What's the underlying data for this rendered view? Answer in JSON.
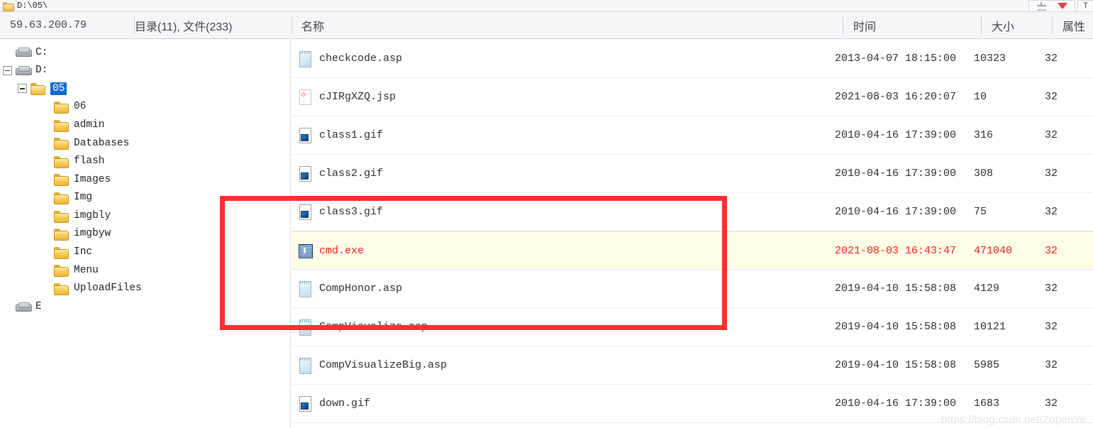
{
  "titlebar": {
    "path": "D:\\05\\",
    "folder_icon": "folder-icon",
    "controls": [
      {
        "name": "plus-minus-icon",
        "label": ""
      },
      {
        "name": "chevron-down-icon",
        "label": ""
      }
    ],
    "edge_label": "T"
  },
  "header": {
    "ip": "59.63.200.79",
    "stats": "目录(11), 文件(233)",
    "col_name": "名称",
    "col_time": "时间",
    "col_size": "大小",
    "col_attr": "属性"
  },
  "tree": {
    "nodes": [
      {
        "label": "C:",
        "icon": "drive-icon",
        "indent": 0,
        "expander": "none",
        "selected": false
      },
      {
        "label": "D:",
        "icon": "drive-icon",
        "indent": 0,
        "expander": "collapse",
        "selected": false
      },
      {
        "label": "05",
        "icon": "folder-open-icon",
        "indent": 1,
        "expander": "collapse",
        "selected": true
      },
      {
        "label": "06",
        "icon": "folder-icon",
        "indent": 2,
        "expander": "none",
        "selected": false
      },
      {
        "label": "admin",
        "icon": "folder-icon",
        "indent": 2,
        "expander": "none",
        "selected": false
      },
      {
        "label": "Databases",
        "icon": "folder-icon",
        "indent": 2,
        "expander": "none",
        "selected": false
      },
      {
        "label": "flash",
        "icon": "folder-icon",
        "indent": 2,
        "expander": "none",
        "selected": false
      },
      {
        "label": "Images",
        "icon": "folder-icon",
        "indent": 2,
        "expander": "none",
        "selected": false
      },
      {
        "label": "Img",
        "icon": "folder-icon",
        "indent": 2,
        "expander": "none",
        "selected": false
      },
      {
        "label": "imgbly",
        "icon": "folder-icon",
        "indent": 2,
        "expander": "none",
        "selected": false
      },
      {
        "label": "imgbyw",
        "icon": "folder-icon",
        "indent": 2,
        "expander": "none",
        "selected": false
      },
      {
        "label": "Inc",
        "icon": "folder-icon",
        "indent": 2,
        "expander": "none",
        "selected": false
      },
      {
        "label": "Menu",
        "icon": "folder-icon",
        "indent": 2,
        "expander": "none",
        "selected": false
      },
      {
        "label": "UploadFiles",
        "icon": "folder-icon",
        "indent": 2,
        "expander": "none",
        "selected": false
      },
      {
        "label": "E",
        "icon": "drive-icon",
        "indent": 0,
        "expander": "none",
        "selected": false
      }
    ]
  },
  "files": {
    "rows": [
      {
        "name": "checkcode.asp",
        "icon": "asp-document-icon",
        "time": "2013-04-07 18:15:00",
        "size": "10323",
        "attr": "32",
        "highlighted": false
      },
      {
        "name": "cJIRgXZQ.jsp",
        "icon": "jsp-code-icon",
        "time": "2021-08-03 16:20:07",
        "size": "10",
        "attr": "32",
        "highlighted": false
      },
      {
        "name": "class1.gif",
        "icon": "gif-image-icon",
        "time": "2010-04-16 17:39:00",
        "size": "316",
        "attr": "32",
        "highlighted": false
      },
      {
        "name": "class2.gif",
        "icon": "gif-image-icon",
        "time": "2010-04-16 17:39:00",
        "size": "308",
        "attr": "32",
        "highlighted": false
      },
      {
        "name": "class3.gif",
        "icon": "gif-image-icon",
        "time": "2010-04-16 17:39:00",
        "size": "75",
        "attr": "32",
        "highlighted": false
      },
      {
        "name": "cmd.exe",
        "icon": "exe-application-icon",
        "time": "2021-08-03 16:43:47",
        "size": "471040",
        "attr": "32",
        "highlighted": true
      },
      {
        "name": "CompHonor.asp",
        "icon": "asp-document-icon",
        "time": "2019-04-10 15:58:08",
        "size": "4129",
        "attr": "32",
        "highlighted": false
      },
      {
        "name": "CompVisualize.asp",
        "icon": "asp-document-icon",
        "time": "2019-04-10 15:58:08",
        "size": "10121",
        "attr": "32",
        "highlighted": false
      },
      {
        "name": "CompVisualizeBig.asp",
        "icon": "asp-document-icon",
        "time": "2019-04-10 15:58:08",
        "size": "5985",
        "attr": "32",
        "highlighted": false
      },
      {
        "name": "down.gif",
        "icon": "gif-image-icon",
        "time": "2010-04-16 17:39:00",
        "size": "1683",
        "attr": "32",
        "highlighted": false
      }
    ]
  },
  "annotation": {
    "color": "#f8302f"
  },
  "watermark": {
    "text": "https://blog.csdn.net/ZripenYe"
  },
  "colors": {
    "highlight_row_bg": "#fdfde8",
    "highlight_row_text": "#f41a1a",
    "selection_bg": "#1669cf",
    "annotation_red": "#f8302f"
  }
}
